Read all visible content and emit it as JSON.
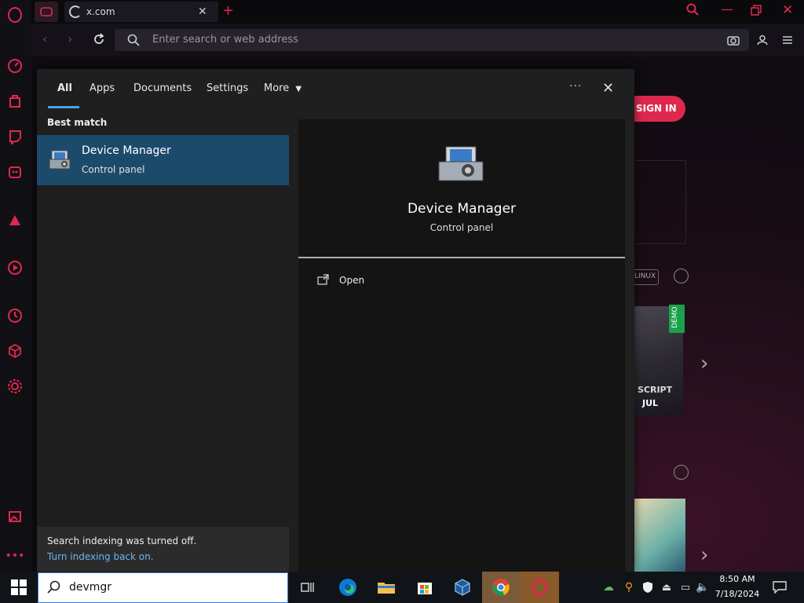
{
  "browser": {
    "tab_title": "x.com",
    "address_placeholder": "Enter search or web address"
  },
  "page": {
    "sign_in": "SIGN IN",
    "linux_badge": "LINUX",
    "demo_badge": "DEMO",
    "game_text": "SCRIPT",
    "game_date": "JUL"
  },
  "search": {
    "nav": {
      "all": "All",
      "apps": "Apps",
      "documents": "Documents",
      "settings": "Settings",
      "more": "More"
    },
    "best_match_label": "Best match",
    "result": {
      "title": "Device Manager",
      "subtitle": "Control panel"
    },
    "preview": {
      "title": "Device Manager",
      "subtitle": "Control panel",
      "action": "Open"
    },
    "indexing_notice": "Search indexing was turned off.",
    "indexing_link": "Turn indexing back on.",
    "query": "devmgr"
  },
  "taskbar": {
    "time": "8:50 AM",
    "date": "7/18/2024"
  },
  "colors": {
    "accent": "#e0284f",
    "selection": "#1c4a6b",
    "taskbar": "#101418"
  }
}
